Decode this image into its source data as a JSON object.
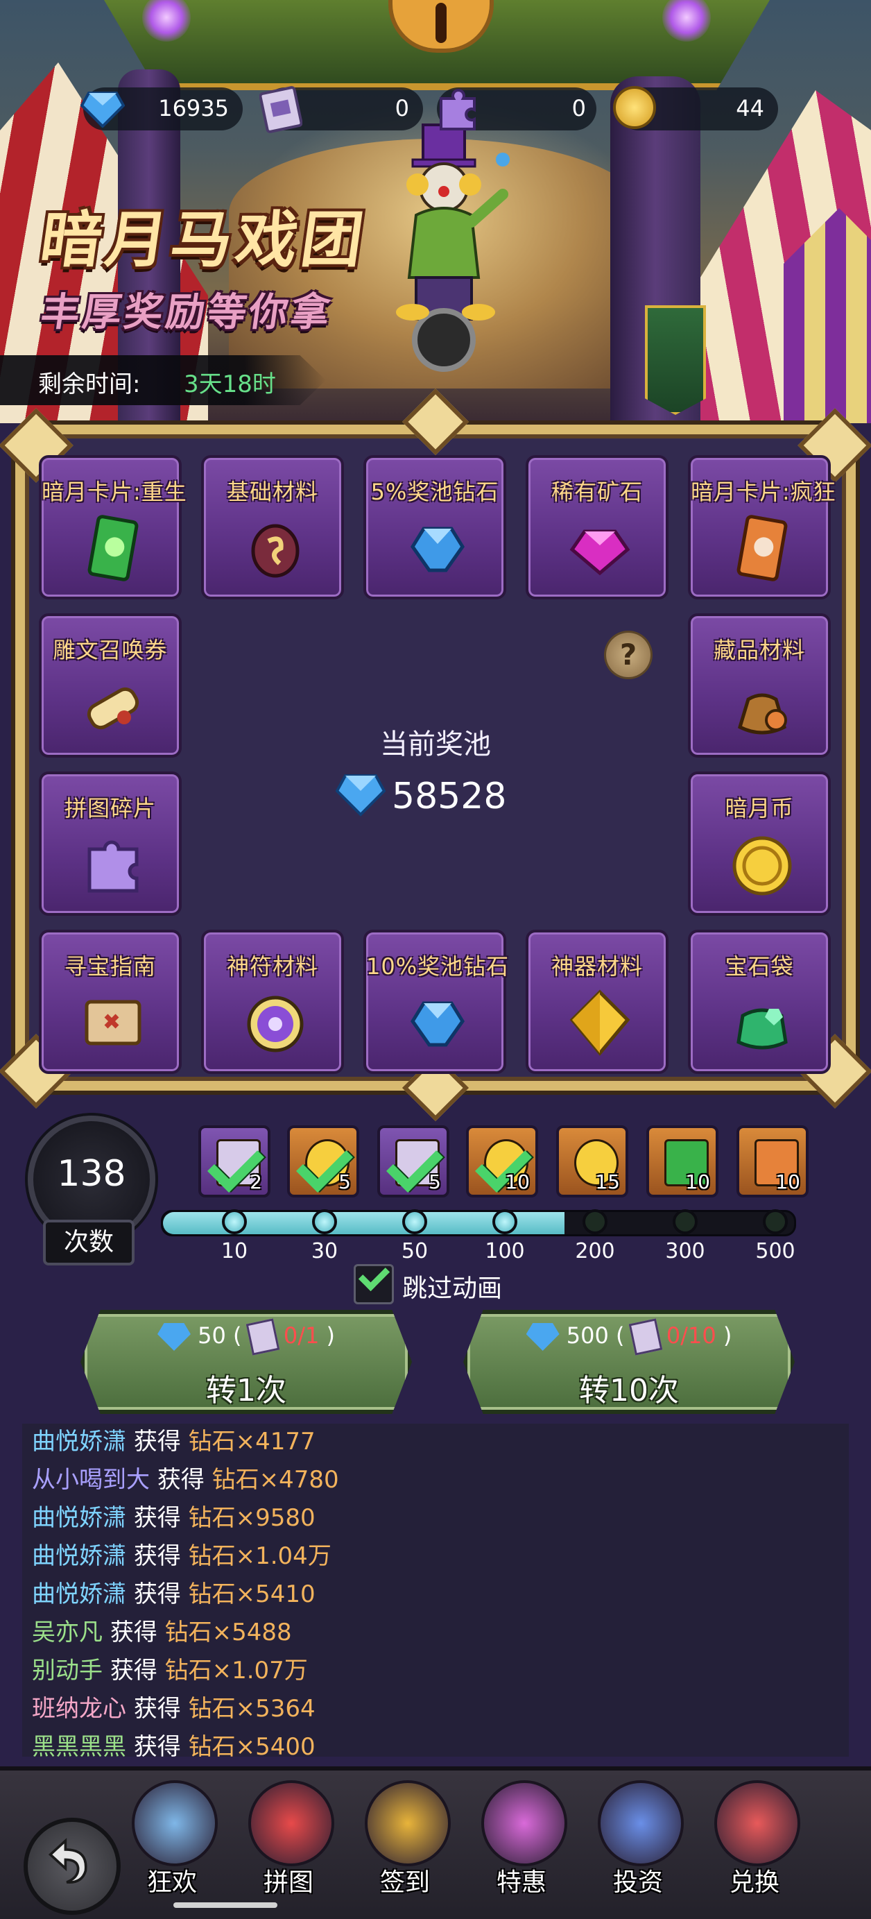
{
  "currency": {
    "diamond": "16935",
    "ticket": "0",
    "puzzle": "0",
    "coin": "44"
  },
  "event": {
    "title": "暗月马戏团",
    "subtitle": "丰厚奖励等你拿",
    "timer_label": "剩余时间:",
    "timer_value": "3天18时"
  },
  "board": {
    "cells": [
      {
        "label": "暗月卡片:重生",
        "icon": "green-card-icon"
      },
      {
        "label": "基础材料",
        "icon": "rune-stone-icon"
      },
      {
        "label": "5%奖池钻石",
        "icon": "blue-diamond-icon"
      },
      {
        "label": "稀有矿石",
        "icon": "pink-gem-icon"
      },
      {
        "label": "暗月卡片:疯狂",
        "icon": "orange-card-icon"
      },
      {
        "label": "雕文召唤券",
        "icon": "scroll-icon"
      },
      {
        "label": "藏品材料",
        "icon": "pouch-icon"
      },
      {
        "label": "拼图碎片",
        "icon": "puzzle-icon"
      },
      {
        "label": "暗月币",
        "icon": "gold-coin-icon"
      },
      {
        "label": "寻宝指南",
        "icon": "treasure-map-icon"
      },
      {
        "label": "神符材料",
        "icon": "rune-orb-icon"
      },
      {
        "label": "10%奖池钻石",
        "icon": "blue-diamond-icon"
      },
      {
        "label": "神器材料",
        "icon": "yellow-crystal-icon"
      },
      {
        "label": "宝石袋",
        "icon": "green-gem-bag-icon"
      }
    ],
    "pool_label": "当前奖池",
    "pool_value": "58528"
  },
  "progress": {
    "count": "138",
    "count_label": "次数",
    "rewards": [
      {
        "count": "2",
        "claimed": true,
        "style": "purple",
        "icon": "ticket-icon"
      },
      {
        "count": "5",
        "claimed": true,
        "style": "orange",
        "icon": "gold-coin-icon"
      },
      {
        "count": "5",
        "claimed": true,
        "style": "purple",
        "icon": "ticket-icon"
      },
      {
        "count": "10",
        "claimed": true,
        "style": "orange",
        "icon": "gold-coin-icon"
      },
      {
        "count": "15",
        "claimed": false,
        "style": "orange",
        "icon": "gold-coin-icon"
      },
      {
        "count": "10",
        "claimed": false,
        "style": "orange",
        "icon": "green-card-icon"
      },
      {
        "count": "10",
        "claimed": false,
        "style": "orange",
        "icon": "orange-card-icon"
      }
    ],
    "milestones": [
      "10",
      "30",
      "50",
      "100",
      "200",
      "300",
      "500"
    ],
    "reached": 4,
    "fill_fraction": 0.64,
    "skip_label": "跳过动画",
    "skip_checked": true
  },
  "buttons": {
    "spin1": {
      "cost": "50",
      "ticket": "0/1",
      "label": "转1次"
    },
    "spin10": {
      "cost": "500",
      "ticket": "0/10",
      "label": "转10次"
    }
  },
  "log": [
    {
      "name": "曲悦娇潇",
      "action": "获得",
      "item": "钻石×4177",
      "color": "#7fd4ff"
    },
    {
      "name": "从小喝到大",
      "action": "获得",
      "item": "钻石×4780",
      "color": "#a9a0ff"
    },
    {
      "name": "曲悦娇潇",
      "action": "获得",
      "item": "钻石×9580",
      "color": "#7fd4ff"
    },
    {
      "name": "曲悦娇潇",
      "action": "获得",
      "item": "钻石×1.04万",
      "color": "#7fd4ff"
    },
    {
      "name": "曲悦娇潇",
      "action": "获得",
      "item": "钻石×5410",
      "color": "#7fd4ff"
    },
    {
      "name": "吴亦凡",
      "action": "获得",
      "item": "钻石×5488",
      "color": "#9be08a"
    },
    {
      "name": "别动手",
      "action": "获得",
      "item": "钻石×1.07万",
      "color": "#9be08a"
    },
    {
      "name": "班纳龙心",
      "action": "获得",
      "item": "钻石×5364",
      "color": "#f6a8c8"
    },
    {
      "name": "黑黑黑黑",
      "action": "获得",
      "item": "钻石×5400",
      "color": "#9be08a"
    }
  ],
  "nav": [
    {
      "label": "狂欢",
      "icon": "ferris-wheel-icon"
    },
    {
      "label": "拼图",
      "icon": "clown-face-icon"
    },
    {
      "label": "签到",
      "icon": "jack-in-box-icon"
    },
    {
      "label": "特惠",
      "icon": "balloons-icon"
    },
    {
      "label": "投资",
      "icon": "jester-cards-icon"
    },
    {
      "label": "兑换",
      "icon": "circus-tent-icon"
    }
  ],
  "colors": {
    "timer_value": "#67e08a",
    "cell_label": "#ffd88a",
    "log_item": "#f3b35c",
    "ticket_required": "#ff4d4d"
  }
}
